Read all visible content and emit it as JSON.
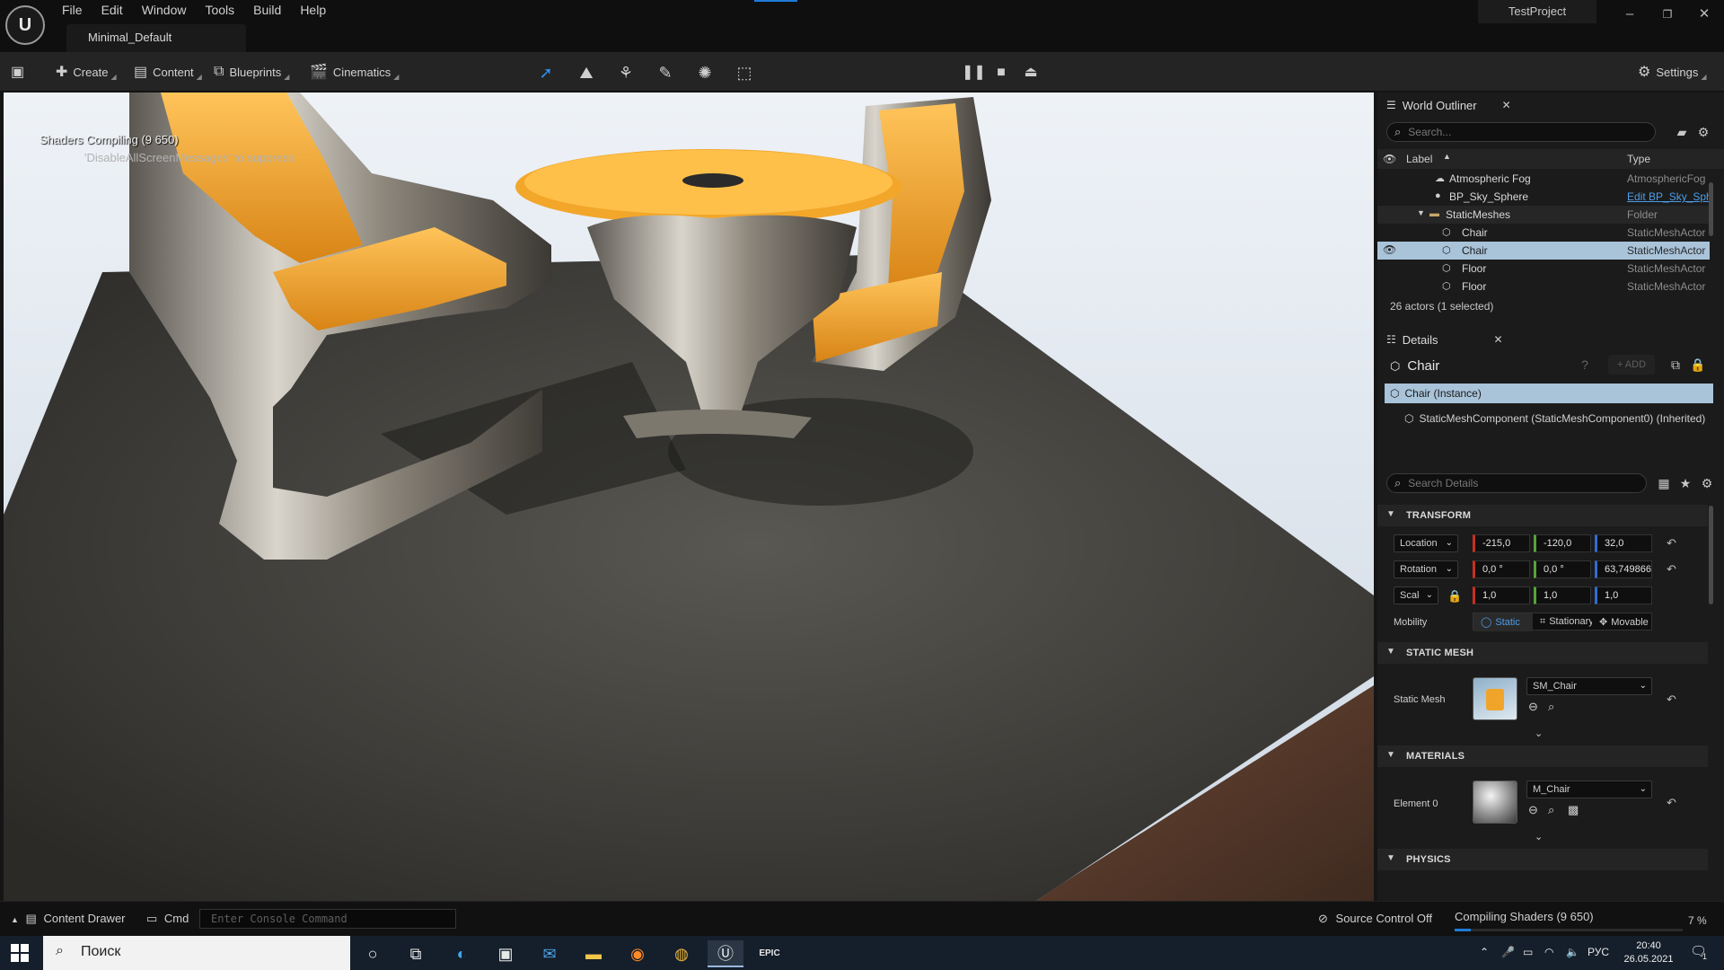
{
  "app": {
    "menu": [
      "File",
      "Edit",
      "Window",
      "Tools",
      "Build",
      "Help"
    ],
    "document_tab": "Minimal_Default",
    "project_name": "TestProject"
  },
  "toolbar": {
    "create_label": "Create",
    "content_label": "Content",
    "blueprints_label": "Blueprints",
    "cinematics_label": "Cinematics",
    "settings_label": "Settings",
    "mode_icons": [
      "select-mode-icon",
      "landscape-mode-icon",
      "foliage-mode-icon",
      "mesh-paint-mode-icon",
      "fracture-mode-icon",
      "modeling-mode-icon"
    ]
  },
  "viewport": {
    "shader_message": "Shaders Compiling (9 650)",
    "suppress_message": "'DisableAllScreenMessages' to suppress"
  },
  "world_outliner": {
    "tab_label": "World Outliner",
    "search_placeholder": "Search...",
    "col_label": "Label",
    "col_type": "Type",
    "rows": [
      {
        "label": "Atmospheric Fog",
        "type": "AtmosphericFog"
      },
      {
        "label": "BP_Sky_Sphere",
        "type": "Edit BP_Sky_Sphere"
      },
      {
        "label": "StaticMeshes",
        "type": "Folder"
      },
      {
        "label": "Chair",
        "type": "StaticMeshActor"
      },
      {
        "label": "Chair",
        "type": "StaticMeshActor"
      },
      {
        "label": "Floor",
        "type": "StaticMeshActor"
      },
      {
        "label": "Floor",
        "type": "StaticMeshActor"
      }
    ],
    "actor_count": "26 actors (1 selected)"
  },
  "details": {
    "tab_label": "Details",
    "title": "Chair",
    "add_label": "+ ADD",
    "instance_label": "Chair  (Instance)",
    "component_label": "StaticMeshComponent (StaticMeshComponent0) (Inherited)",
    "search_placeholder": "Search Details",
    "transform": {
      "section": "TRANSFORM",
      "location_label": "Location",
      "rotation_label": "Rotation",
      "scale_label": "Scale",
      "location": [
        "-215,0",
        "-120,0",
        "32,0"
      ],
      "rotation": [
        "0,0 °",
        "0,0 °",
        "63,749866"
      ],
      "scale": [
        "1,0",
        "1,0",
        "1,0"
      ],
      "mobility_label": "Mobility",
      "mobility_options": [
        "Static",
        "Stationary",
        "Movable"
      ],
      "mobility_selected": "Static"
    },
    "static_mesh": {
      "section": "STATIC MESH",
      "label": "Static Mesh",
      "value": "SM_Chair"
    },
    "materials": {
      "section": "MATERIALS",
      "label": "Element 0",
      "value": "M_Chair"
    },
    "physics": {
      "section": "PHYSICS"
    }
  },
  "statusbar": {
    "content_drawer": "Content Drawer",
    "cmd": "Cmd",
    "console_placeholder": "Enter Console Command",
    "source_control": "Source Control Off",
    "compiling": "Compiling Shaders (9 650)",
    "percent": "7 %",
    "progress": 0.07
  },
  "taskbar": {
    "search_text": "Поиск",
    "language": "РУС",
    "time": "20:40",
    "date": "26.05.2021",
    "notifications": "1"
  },
  "colors": {
    "accent": "#1f7ad8",
    "selection": "#a9c3d9",
    "seat": "#f0a52a"
  }
}
